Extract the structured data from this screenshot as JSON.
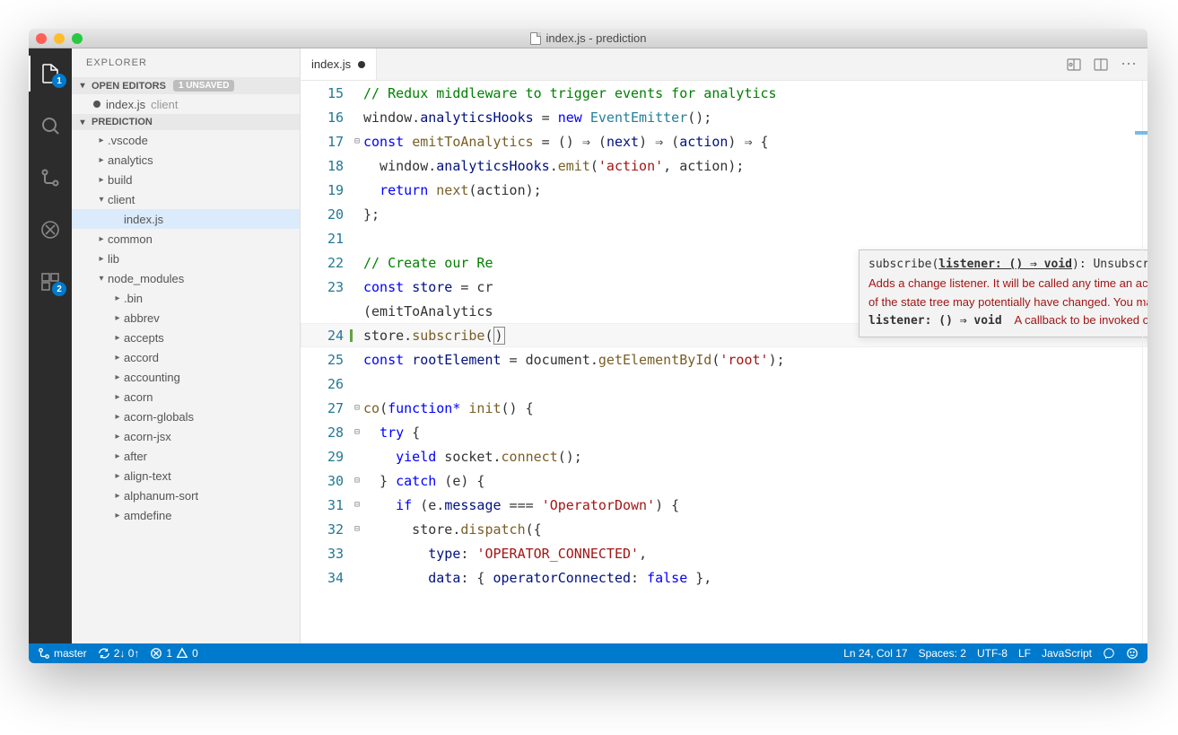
{
  "window": {
    "title": "index.js - prediction"
  },
  "activity": {
    "explorer_badge": "1",
    "scm_badge": "2"
  },
  "sidebar": {
    "title": "EXPLORER",
    "open_editors_label": "OPEN EDITORS",
    "unsaved_label": "1 UNSAVED",
    "open_editor_file": "index.js",
    "open_editor_dir": "client",
    "project_label": "PREDICTION",
    "tree": [
      {
        "name": ".vscode",
        "type": "folder",
        "depth": 1,
        "expanded": false
      },
      {
        "name": "analytics",
        "type": "folder",
        "depth": 1,
        "expanded": false
      },
      {
        "name": "build",
        "type": "folder",
        "depth": 1,
        "expanded": false
      },
      {
        "name": "client",
        "type": "folder",
        "depth": 1,
        "expanded": true
      },
      {
        "name": "index.js",
        "type": "file",
        "depth": 2,
        "selected": true
      },
      {
        "name": "common",
        "type": "folder",
        "depth": 1,
        "expanded": false
      },
      {
        "name": "lib",
        "type": "folder",
        "depth": 1,
        "expanded": false
      },
      {
        "name": "node_modules",
        "type": "folder",
        "depth": 1,
        "expanded": true
      },
      {
        "name": ".bin",
        "type": "folder",
        "depth": 2,
        "expanded": false
      },
      {
        "name": "abbrev",
        "type": "folder",
        "depth": 2,
        "expanded": false
      },
      {
        "name": "accepts",
        "type": "folder",
        "depth": 2,
        "expanded": false
      },
      {
        "name": "accord",
        "type": "folder",
        "depth": 2,
        "expanded": false
      },
      {
        "name": "accounting",
        "type": "folder",
        "depth": 2,
        "expanded": false
      },
      {
        "name": "acorn",
        "type": "folder",
        "depth": 2,
        "expanded": false
      },
      {
        "name": "acorn-globals",
        "type": "folder",
        "depth": 2,
        "expanded": false
      },
      {
        "name": "acorn-jsx",
        "type": "folder",
        "depth": 2,
        "expanded": false
      },
      {
        "name": "after",
        "type": "folder",
        "depth": 2,
        "expanded": false
      },
      {
        "name": "align-text",
        "type": "folder",
        "depth": 2,
        "expanded": false
      },
      {
        "name": "alphanum-sort",
        "type": "folder",
        "depth": 2,
        "expanded": false
      },
      {
        "name": "amdefine",
        "type": "folder",
        "depth": 2,
        "expanded": false
      }
    ]
  },
  "tab": {
    "label": "index.js"
  },
  "code_lines": [
    {
      "n": 15,
      "html": "<span class='tok-comment'>// Redux middleware to trigger events for analytics</span>"
    },
    {
      "n": 16,
      "html": "window.<span class='tok-prop'>analyticsHooks</span> = <span class='tok-kw'>new</span> <span class='tok-type'>EventEmitter</span>();"
    },
    {
      "n": 17,
      "fold": "⊟",
      "html": "<span class='tok-kw'>const</span> <span class='tok-fn'>emitToAnalytics</span> = () ⇒ (<span class='tok-prop'>next</span>) ⇒ (<span class='tok-prop'>action</span>) ⇒ {"
    },
    {
      "n": 18,
      "html": "  window.<span class='tok-prop'>analyticsHooks</span>.<span class='tok-fn'>emit</span>(<span class='tok-str'>'action'</span>, action);"
    },
    {
      "n": 19,
      "html": "  <span class='tok-kw'>return</span> <span class='tok-fn'>next</span>(action);"
    },
    {
      "n": 20,
      "html": "};"
    },
    {
      "n": 21,
      "html": ""
    },
    {
      "n": 22,
      "html": "<span class='tok-comment'>// Create our Re</span>"
    },
    {
      "n": 23,
      "html": "<span class='tok-kw'>const</span> <span class='tok-prop'>store</span> = cr"
    },
    {
      "n": "",
      "html": "(emitToAnalytics"
    },
    {
      "n": 24,
      "active": true,
      "html": "store.<span class='tok-fn'>subscribe</span>(<span class='cursor-box'>)</span>"
    },
    {
      "n": 25,
      "html": "<span class='tok-kw'>const</span> <span class='tok-prop'>rootElement</span> = document.<span class='tok-fn'>getElementById</span>(<span class='tok-str'>'root'</span>);"
    },
    {
      "n": 26,
      "html": ""
    },
    {
      "n": 27,
      "fold": "⊟",
      "html": "<span class='tok-fn'>co</span>(<span class='tok-kw'>function*</span> <span class='tok-fn'>init</span>() {"
    },
    {
      "n": 28,
      "fold": "⊟",
      "html": "  <span class='tok-kw'>try</span> {"
    },
    {
      "n": 29,
      "html": "    <span class='tok-kw'>yield</span> socket.<span class='tok-fn'>connect</span>();"
    },
    {
      "n": 30,
      "fold": "⊟",
      "html": "  } <span class='tok-kw'>catch</span> (e) {"
    },
    {
      "n": 31,
      "fold": "⊟",
      "html": "    <span class='tok-kw'>if</span> (e.<span class='tok-prop'>message</span> === <span class='tok-str'>'OperatorDown'</span>) {"
    },
    {
      "n": 32,
      "fold": "⊟",
      "html": "      store.<span class='tok-fn'>dispatch</span>({"
    },
    {
      "n": 33,
      "html": "        <span class='tok-prop'>type</span>: <span class='tok-str'>'OPERATOR_CONNECTED'</span>,"
    },
    {
      "n": 34,
      "html": "        <span class='tok-prop'>data</span>: { <span class='tok-prop'>operatorConnected</span>: <span class='tok-kw'>false</span> },"
    }
  ],
  "tooltip": {
    "signature_prefix": "subscribe(",
    "signature_param": "listener: () ⇒ void",
    "signature_suffix": "): Unsubscribe",
    "doc": "Adds a change listener. It will be called any time an action is dispatched, and some part of the state tree may potentially have changed. You may",
    "param_label": "listener: () ⇒ void",
    "param_doc": "A callback to be invoked on every dispatch."
  },
  "status": {
    "branch": "master",
    "sync": "2↓ 0↑",
    "errors": "1",
    "warnings": "0",
    "position": "Ln 24, Col 17",
    "spaces": "Spaces: 2",
    "encoding": "UTF-8",
    "eol": "LF",
    "language": "JavaScript"
  }
}
